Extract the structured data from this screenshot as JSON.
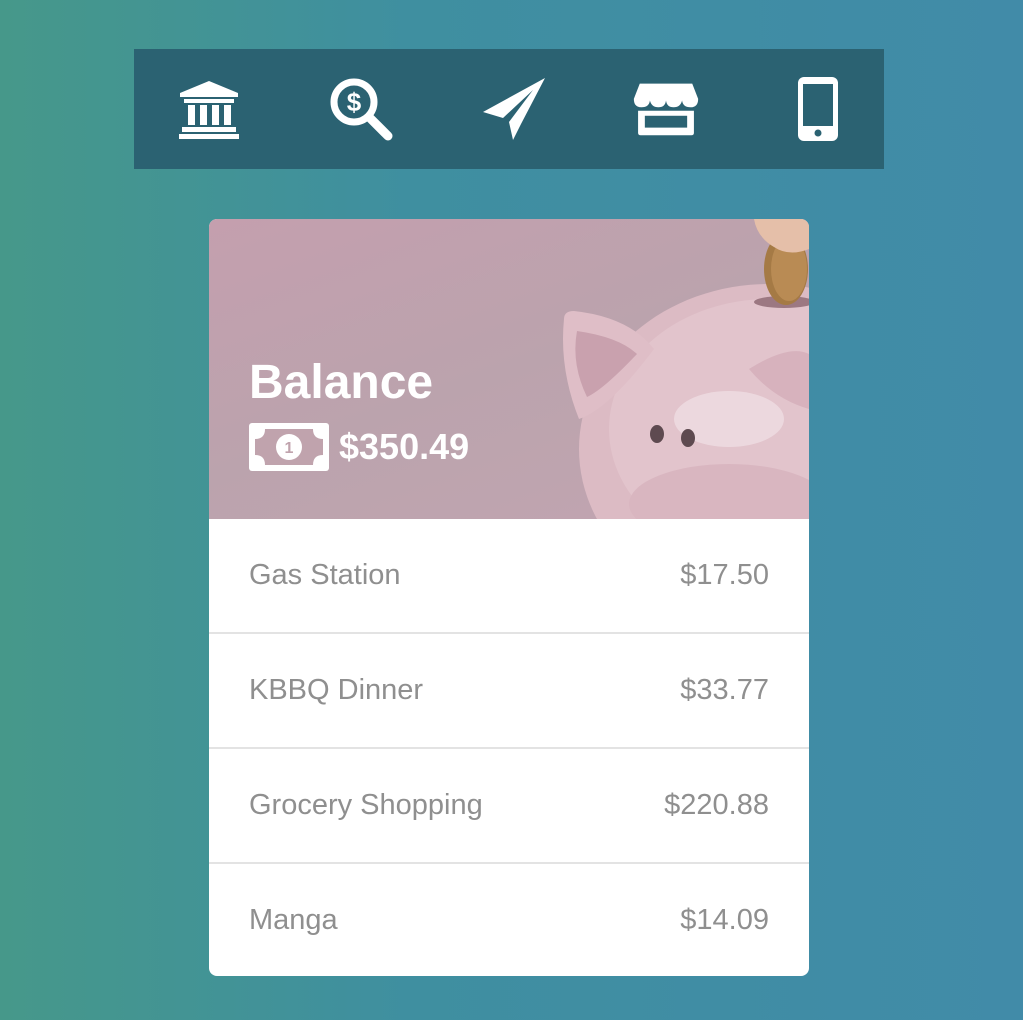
{
  "toolbar": {
    "items": [
      {
        "icon": "bank-icon"
      },
      {
        "icon": "search-dollar-icon"
      },
      {
        "icon": "paper-plane-icon"
      },
      {
        "icon": "store-icon"
      },
      {
        "icon": "mobile-phone-icon"
      }
    ]
  },
  "balance": {
    "title": "Balance",
    "amount": "$350.49",
    "icon": "money-bill-icon"
  },
  "transactions": [
    {
      "name": "Gas Station",
      "amount": "$17.50"
    },
    {
      "name": "KBBQ Dinner",
      "amount": "$33.77"
    },
    {
      "name": "Grocery Shopping",
      "amount": "$220.88"
    },
    {
      "name": "Manga",
      "amount": "$14.09"
    }
  ],
  "colors": {
    "background_gradient": [
      "#46988a",
      "#418ba8"
    ],
    "toolbar": "#2b6272",
    "hero": "#c1a3af",
    "text_muted": "#8f8f8f",
    "divider": "#e3e3e3"
  }
}
